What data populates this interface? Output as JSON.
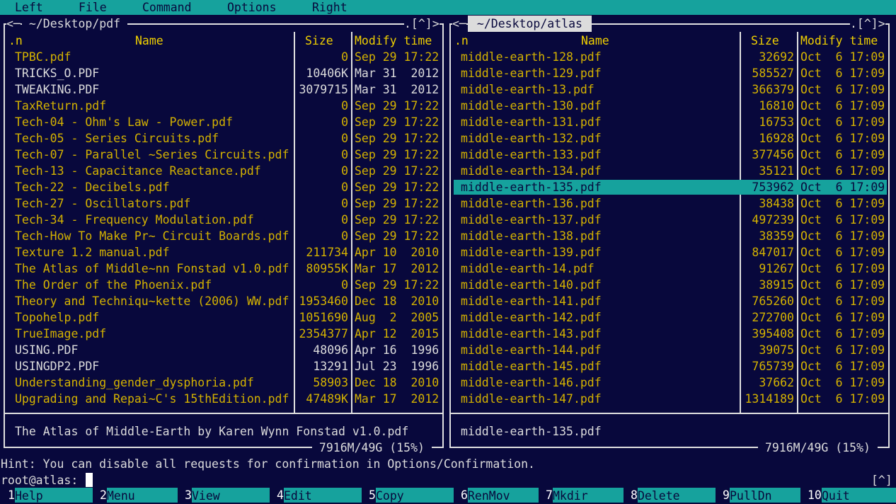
{
  "menu": [
    "Left",
    "File",
    "Command",
    "Options",
    "Right"
  ],
  "left_panel": {
    "path": " ~/Desktop/pdf ",
    "left_marker": "<─",
    "right_marker": ".[^]>",
    "headers": {
      "sort": ".n",
      "name": "Name",
      "size": "Size",
      "time": "Modify time"
    },
    "files": [
      {
        "name": "TPBC.pdf",
        "size": "0",
        "date": "Sep 29 17:22",
        "exe": true
      },
      {
        "name": "TRICKS_O.PDF",
        "size": "10406K",
        "date": "Mar 31  2012",
        "exe": false
      },
      {
        "name": "TWEAKING.PDF",
        "size": "3079715",
        "date": "Mar 31  2012",
        "exe": false
      },
      {
        "name": "TaxReturn.pdf",
        "size": "0",
        "date": "Sep 29 17:22",
        "exe": true
      },
      {
        "name": "Tech-04 - Ohm's Law - Power.pdf",
        "size": "0",
        "date": "Sep 29 17:22",
        "exe": true
      },
      {
        "name": "Tech-05 - Series Circuits.pdf",
        "size": "0",
        "date": "Sep 29 17:22",
        "exe": true
      },
      {
        "name": "Tech-07 - Parallel ~Series Circuits.pdf",
        "size": "0",
        "date": "Sep 29 17:22",
        "exe": true
      },
      {
        "name": "Tech-13 - Capacitance Reactance.pdf",
        "size": "0",
        "date": "Sep 29 17:22",
        "exe": true
      },
      {
        "name": "Tech-22 - Decibels.pdf",
        "size": "0",
        "date": "Sep 29 17:22",
        "exe": true
      },
      {
        "name": "Tech-27 - Oscillators.pdf",
        "size": "0",
        "date": "Sep 29 17:22",
        "exe": true
      },
      {
        "name": "Tech-34 - Frequency Modulation.pdf",
        "size": "0",
        "date": "Sep 29 17:22",
        "exe": true
      },
      {
        "name": "Tech-How To Make Pr~ Circuit Boards.pdf",
        "size": "0",
        "date": "Sep 29 17:22",
        "exe": true
      },
      {
        "name": "Texture 1.2 manual.pdf",
        "size": "211734",
        "date": "Apr 10  2010",
        "exe": true
      },
      {
        "name": "The Atlas of Middle~nn Fonstad v1.0.pdf",
        "size": "80955K",
        "date": "Mar 17  2012",
        "exe": true
      },
      {
        "name": "The Order of the Phoenix.pdf",
        "size": "0",
        "date": "Sep 29 17:22",
        "exe": true
      },
      {
        "name": "Theory and Techniqu~kette (2006) WW.pdf",
        "size": "1953460",
        "date": "Dec 18  2010",
        "exe": true
      },
      {
        "name": "Topohelp.pdf",
        "size": "1051690",
        "date": "Aug  2  2005",
        "exe": true
      },
      {
        "name": "TrueImage.pdf",
        "size": "2354377",
        "date": "Apr 12  2015",
        "exe": true
      },
      {
        "name": "USING.PDF",
        "size": "48096",
        "date": "Apr 16  1996",
        "exe": false
      },
      {
        "name": "USINGDP2.PDF",
        "size": "13291",
        "date": "Jul 23  1996",
        "exe": false
      },
      {
        "name": "Understanding_gender_dysphoria.pdf",
        "size": "58903",
        "date": "Dec 18  2010",
        "exe": true
      },
      {
        "name": "Upgrading and Repai~C's 15thEdition.pdf",
        "size": "47489K",
        "date": "Mar 17  2012",
        "exe": true
      }
    ],
    "status": "The Atlas of Middle-Earth by Karen Wynn Fonstad v1.0.pdf",
    "disk": " 7916M/49G (15%) "
  },
  "right_panel": {
    "path": " ~/Desktop/atlas ",
    "left_marker": "<─",
    "right_marker": ".[^]>",
    "headers": {
      "sort": ".n",
      "name": "Name",
      "size": "Size",
      "time": "Modify time"
    },
    "selected_index": 8,
    "files": [
      {
        "name": "middle-earth-128.pdf",
        "size": "32692",
        "date": "Oct  6 17:09"
      },
      {
        "name": "middle-earth-129.pdf",
        "size": "585527",
        "date": "Oct  6 17:09"
      },
      {
        "name": "middle-earth-13.pdf",
        "size": "366379",
        "date": "Oct  6 17:09"
      },
      {
        "name": "middle-earth-130.pdf",
        "size": "16810",
        "date": "Oct  6 17:09"
      },
      {
        "name": "middle-earth-131.pdf",
        "size": "16753",
        "date": "Oct  6 17:09"
      },
      {
        "name": "middle-earth-132.pdf",
        "size": "16928",
        "date": "Oct  6 17:09"
      },
      {
        "name": "middle-earth-133.pdf",
        "size": "377456",
        "date": "Oct  6 17:09"
      },
      {
        "name": "middle-earth-134.pdf",
        "size": "35121",
        "date": "Oct  6 17:09"
      },
      {
        "name": "middle-earth-135.pdf",
        "size": "753962",
        "date": "Oct  6 17:09"
      },
      {
        "name": "middle-earth-136.pdf",
        "size": "38438",
        "date": "Oct  6 17:09"
      },
      {
        "name": "middle-earth-137.pdf",
        "size": "497239",
        "date": "Oct  6 17:09"
      },
      {
        "name": "middle-earth-138.pdf",
        "size": "38359",
        "date": "Oct  6 17:09"
      },
      {
        "name": "middle-earth-139.pdf",
        "size": "847017",
        "date": "Oct  6 17:09"
      },
      {
        "name": "middle-earth-14.pdf",
        "size": "91267",
        "date": "Oct  6 17:09"
      },
      {
        "name": "middle-earth-140.pdf",
        "size": "38915",
        "date": "Oct  6 17:09"
      },
      {
        "name": "middle-earth-141.pdf",
        "size": "765260",
        "date": "Oct  6 17:09"
      },
      {
        "name": "middle-earth-142.pdf",
        "size": "272700",
        "date": "Oct  6 17:09"
      },
      {
        "name": "middle-earth-143.pdf",
        "size": "395408",
        "date": "Oct  6 17:09"
      },
      {
        "name": "middle-earth-144.pdf",
        "size": "39075",
        "date": "Oct  6 17:09"
      },
      {
        "name": "middle-earth-145.pdf",
        "size": "765739",
        "date": "Oct  6 17:09"
      },
      {
        "name": "middle-earth-146.pdf",
        "size": "37662",
        "date": "Oct  6 17:09"
      },
      {
        "name": "middle-earth-147.pdf",
        "size": "1314189",
        "date": "Oct  6 17:09"
      }
    ],
    "status": "middle-earth-135.pdf",
    "disk": " 7916M/49G (15%) "
  },
  "hint": "Hint: You can disable all requests for confirmation in Options/Confirmation.",
  "prompt": "root@atlas:",
  "prompt_marker": "[^]",
  "fkeys": [
    {
      "num": "1",
      "label": "Help"
    },
    {
      "num": "2",
      "label": "Menu"
    },
    {
      "num": "3",
      "label": "View"
    },
    {
      "num": "4",
      "label": "Edit"
    },
    {
      "num": "5",
      "label": "Copy"
    },
    {
      "num": "6",
      "label": "RenMov"
    },
    {
      "num": "7",
      "label": "Mkdir"
    },
    {
      "num": "8",
      "label": "Delete"
    },
    {
      "num": "9",
      "label": "PullDn"
    },
    {
      "num": "10",
      "label": "Quit"
    }
  ],
  "colors": {
    "bg": "#08083c",
    "accent": "#16a29d",
    "exe_file": "#d4b200",
    "plain_file": "#dcdcdc",
    "header": "#f0d000"
  }
}
